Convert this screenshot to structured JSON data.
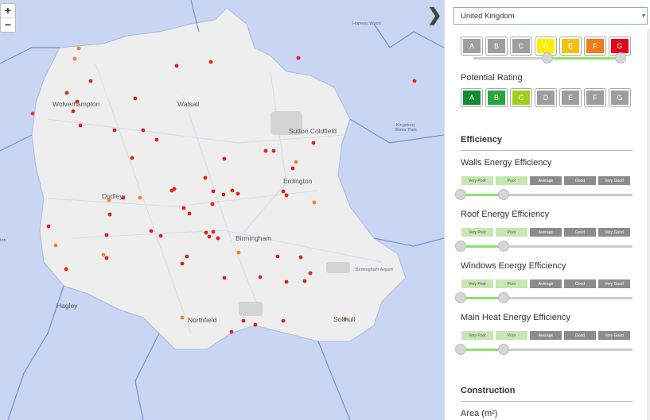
{
  "map": {
    "zoom_in": "+",
    "zoom_out": "−",
    "collapse_icon": "❯",
    "labels": {
      "wolverhampton": "Wolverhampton",
      "walsall": "Walsall",
      "sutton": "Sutton Coldfield",
      "erdington": "Erdington",
      "dudley": "Dudley",
      "birmingham": "Birmingham",
      "hagley": "Hagley",
      "northfield": "Northfield",
      "solihull": "Solihull",
      "airport": "Birmingham Airport",
      "hopwas": "Hopwas Wood",
      "kingsbury": "Kingsbury Water Park",
      "ton": "ton"
    }
  },
  "panel": {
    "country": "United Kingdom",
    "current_ratings": [
      "A",
      "B",
      "C",
      "D",
      "E",
      "F",
      "G"
    ],
    "current_colors": [
      "#9e9e9e",
      "#9e9e9e",
      "#9e9e9e",
      "#ffee00",
      "#f2c017",
      "#ee7d1a",
      "#e2061b"
    ],
    "potential_title": "Potential Rating",
    "potential_ratings": [
      "A",
      "B",
      "C",
      "D",
      "E",
      "F",
      "G"
    ],
    "potential_colors": [
      "#108c32",
      "#2ca53b",
      "#9ecf1c",
      "#9e9e9e",
      "#9e9e9e",
      "#9e9e9e",
      "#9e9e9e"
    ],
    "efficiency_title": "Efficiency",
    "eff_levels": [
      "Very Poor",
      "Poor",
      "Average",
      "Good",
      "Very Good"
    ],
    "walls": "Walls Energy Efficiency",
    "roof": "Roof Energy Efficiency",
    "windows": "Windows Energy Efficiency",
    "heat": "Main Heat Energy Efficiency",
    "construction_title": "Construction",
    "area_label": "Area (m²)"
  }
}
